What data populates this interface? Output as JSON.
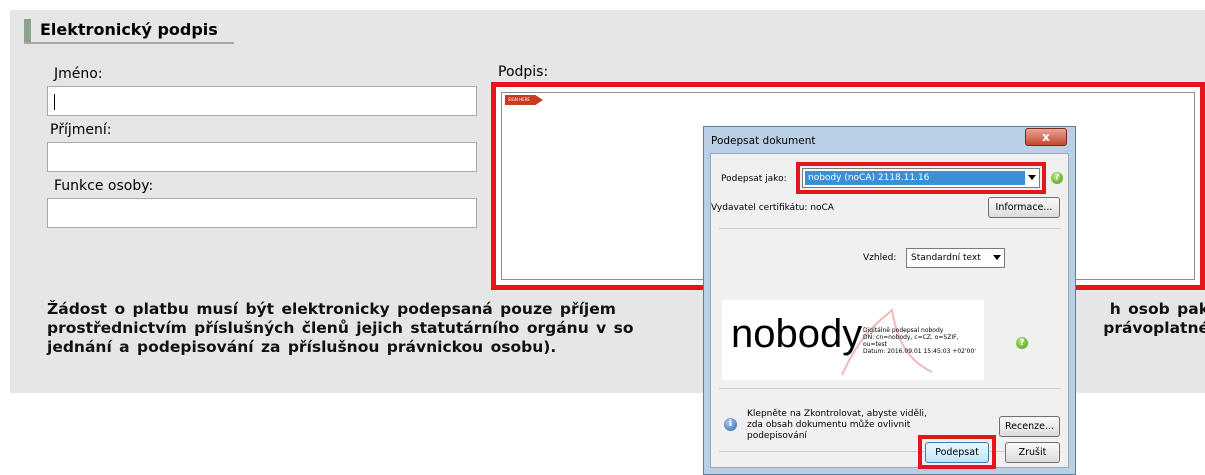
{
  "section": {
    "title": "Elektronický podpis"
  },
  "form": {
    "first_name_label": "Jméno:",
    "first_name_value": "",
    "last_name_label": "Příjmení:",
    "last_name_value": "",
    "function_label": "Funkce osoby:",
    "function_value": "",
    "signature_label": "Podpis:",
    "signature_tag": "SIGN HERE"
  },
  "notice": {
    "text_start": "Žádost o platbu musí být elektronicky podepsaná pouze příjem",
    "text_end_1": "h osob pak",
    "line2_start": "prostřednictvím příslušných členů jejich statutárního orgánu v so",
    "line2_end": "právoplatné",
    "line3": "jednání a podepisování za příslušnou právnickou osobu)."
  },
  "dialog": {
    "title": "Podepsat dokument",
    "close_label": "x",
    "sign_as_label": "Podepsat jako:",
    "sign_as_value": "nobody (noCA) 2118.11.16",
    "issuer_label": "Vydavatel certifikátu: noCA",
    "info_button": "Informace...",
    "appearance_label": "Vzhled:",
    "appearance_value": "Standardní text",
    "preview_name": "nobody",
    "preview_details": "Digitálně podepsal nobody\nDN: cn=nobody, c=CZ, o=SZIF,\nou=test\nDatum: 2016.09.01 15:45:03 +02'00'",
    "check_text": "Klepněte na Zkontrolovat, abyste viděli, zda obsah dokumentu může ovlivnit podepisování",
    "review_button": "Recenze...",
    "sign_button": "Podepsat",
    "cancel_button": "Zrušit"
  },
  "colors": {
    "highlight": "#e3161d",
    "selection": "#3b8fd6",
    "panel": "#e6e6e6",
    "section_accent": "#8aa38a"
  }
}
